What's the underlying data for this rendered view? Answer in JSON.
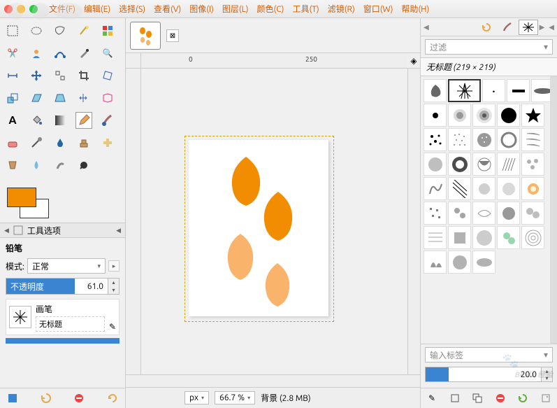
{
  "menus": [
    "文件(F)",
    "编辑(E)",
    "选择(S)",
    "查看(V)",
    "图像(I)",
    "图层(L)",
    "颜色(C)",
    "工具(T)",
    "滤镜(R)",
    "窗口(W)",
    "帮助(H)"
  ],
  "toolOptions": {
    "header": "工具选项",
    "title": "铅笔",
    "modeLabel": "模式:",
    "modeValue": "正常",
    "opacityLabel": "不透明度",
    "opacityValue": "61.0",
    "brushLabel": "画笔",
    "brushName": "无标题"
  },
  "ruler": {
    "mid": "0",
    "q": "250"
  },
  "status": {
    "unit": "px",
    "zoom": "66.7 %",
    "layer": "背景 (2.8 MB)"
  },
  "right": {
    "filterPlaceholder": "过滤",
    "docTitle": "无标题 (219 × 219)",
    "enterTag": "输入标签",
    "spacing": "20.0"
  },
  "colors": {
    "fg": "#f28c00",
    "bg": "#ffffff"
  },
  "watermark": "Baidu 经验"
}
